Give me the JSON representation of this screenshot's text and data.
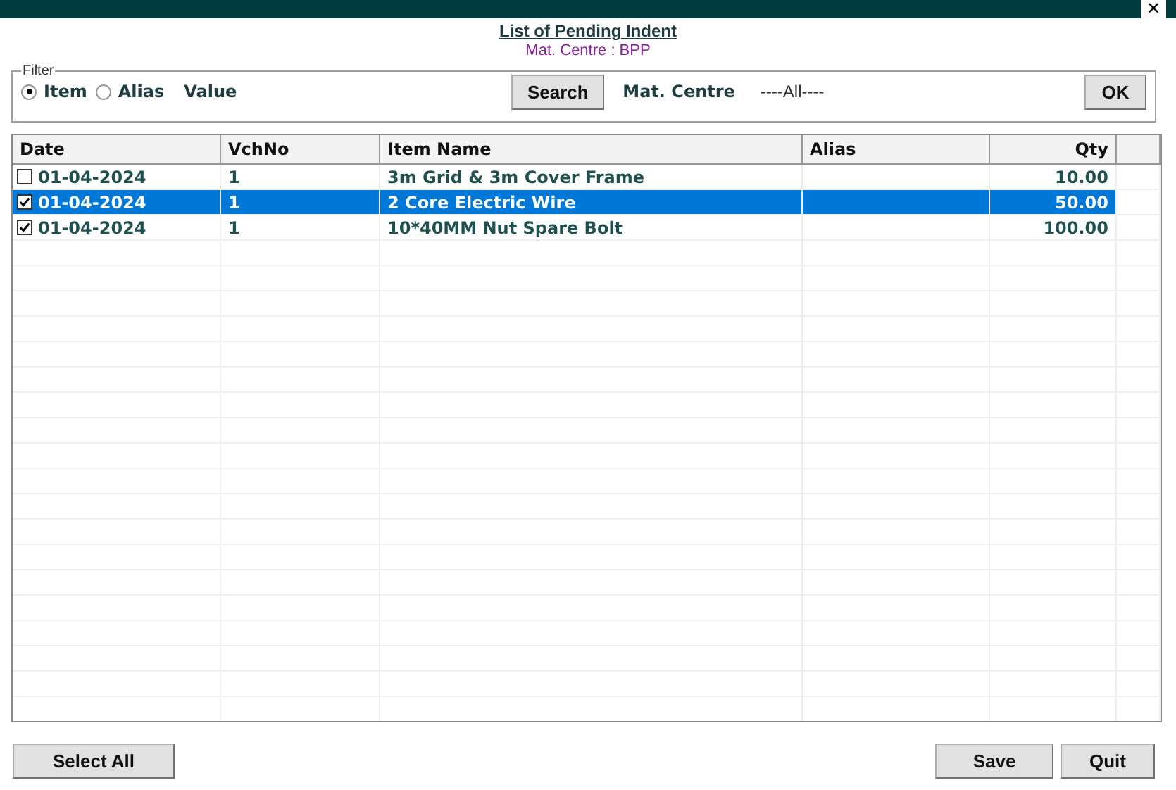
{
  "window": {
    "close": "✕"
  },
  "title": "List of Pending Indent",
  "subtitle": "Mat. Centre : BPP",
  "filter": {
    "legend": "Filter",
    "options": [
      {
        "label": "Item",
        "selected": true
      },
      {
        "label": "Alias",
        "selected": false
      }
    ],
    "value_label": "Value",
    "search": "Search",
    "mat_centre_label": "Mat. Centre",
    "mat_centre_value": "----All----",
    "ok": "OK"
  },
  "table": {
    "columns": [
      "Date",
      "VchNo",
      "Item Name",
      "Alias",
      "Qty"
    ],
    "rows": [
      {
        "checked": false,
        "selected": false,
        "cells": [
          "01-04-2024",
          "1",
          "3m Grid & 3m Cover Frame",
          "",
          "10.00"
        ]
      },
      {
        "checked": true,
        "selected": true,
        "cells": [
          "01-04-2024",
          "1",
          "2 Core Electric Wire",
          "",
          "50.00"
        ]
      },
      {
        "checked": true,
        "selected": false,
        "cells": [
          "01-04-2024",
          "1",
          "10*40MM Nut Spare Bolt",
          "",
          "100.00"
        ]
      }
    ]
  },
  "buttons": {
    "select_all": "Select All",
    "save": "Save",
    "quit": "Quit"
  }
}
